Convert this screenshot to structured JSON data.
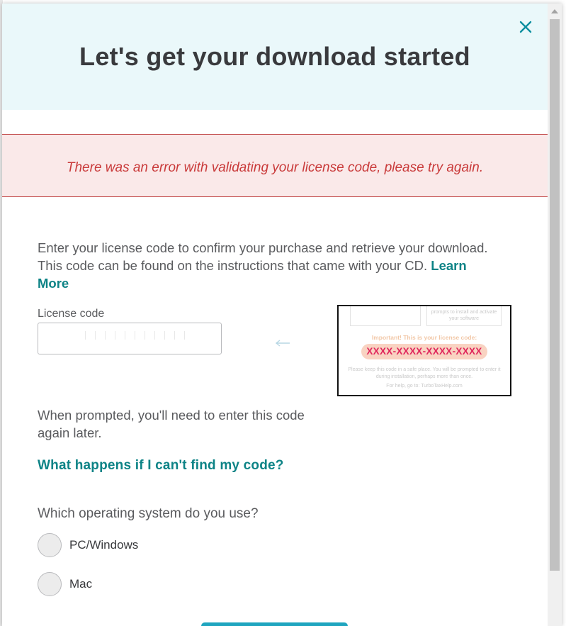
{
  "modal": {
    "title": "Let's get your download started",
    "close_icon": "close-icon"
  },
  "error": {
    "message": "There was an error with validating your license code, please try again."
  },
  "intro": {
    "text": "Enter your license code to confirm your purchase and retrieve your download. This code can be found on the instructions that came with your CD. ",
    "learn_more": "Learn More"
  },
  "license": {
    "label": "License code",
    "value": ""
  },
  "code_image": {
    "top_left_text": "",
    "top_right_text": "prompts to install and activate your software",
    "important": "Important! This is your license code:",
    "code": "XXXX-XXXX-XXXX-XXXX",
    "note": "Please keep this code in a safe place. You will be prompted to enter it during installation, perhaps more than once.",
    "help": "For help, go to: TurboTaxHelp.com"
  },
  "prompt": {
    "text": "When prompted, you'll need to enter this code again later."
  },
  "links": {
    "find_code": "What happens if I can't find my code?"
  },
  "os": {
    "question": "Which operating system do you use?",
    "options": [
      {
        "label": "PC/Windows"
      },
      {
        "label": "Mac"
      }
    ]
  },
  "colors": {
    "header_bg": "#eaf8fa",
    "error_bg": "#fae9e9",
    "error_text": "#c93a3a",
    "link": "#0d8386",
    "button": "#1fa5bf"
  }
}
